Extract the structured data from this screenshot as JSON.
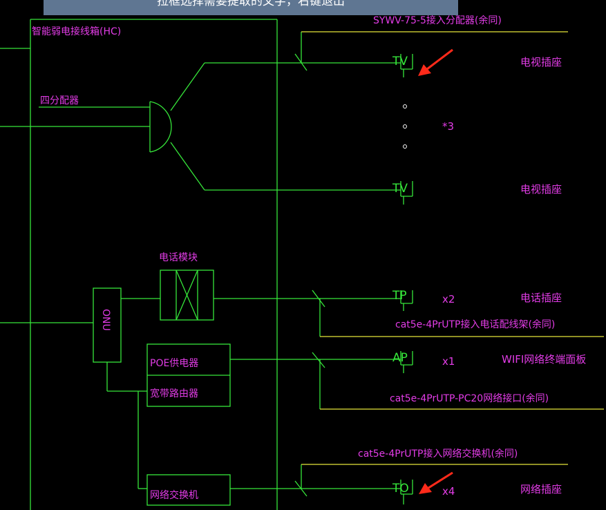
{
  "prompt_bar": {
    "text": "拉框选择需要提取的文字，右键退出"
  },
  "diagram": {
    "title_hc": "智能弱电接线箱(HC)",
    "splitter": "四分配器",
    "tv_cable": "SYWV-75-5接入分配器(余同)",
    "phone_module": "电话模块",
    "onu": "ONU",
    "poe": "POE供电器",
    "router": "宽带路由器",
    "switch": "网络交换机",
    "tv_symbol_1": "TV",
    "tv_symbol_2": "TV",
    "tp_symbol": "TP",
    "ap_symbol": "AP",
    "to_symbol": "TO",
    "tv_outlet_1": "电视插座",
    "tv_outlet_2": "电视插座",
    "tv_mult": "*3",
    "phone_outlet": "电话插座",
    "phone_mult": "x2",
    "phone_cable": "cat5e-4PrUTP接入电话配线架(余同)",
    "wifi_panel": "WIFI网络终端面板",
    "wifi_mult": "x1",
    "ap_cable": "cat5e-4PrUTP-PC20网络接口(余同)",
    "switch_cable": "cat5e-4PrUTP接入网络交换机(余同)",
    "net_outlet": "网络插座",
    "net_mult": "x4"
  },
  "colors": {
    "background": "#000000",
    "line": "#36e63a",
    "yellow": "#e6e63a",
    "text": "#e23ce6",
    "arrow": "#ff2a1a",
    "prompt_bg": "#5f7692"
  }
}
